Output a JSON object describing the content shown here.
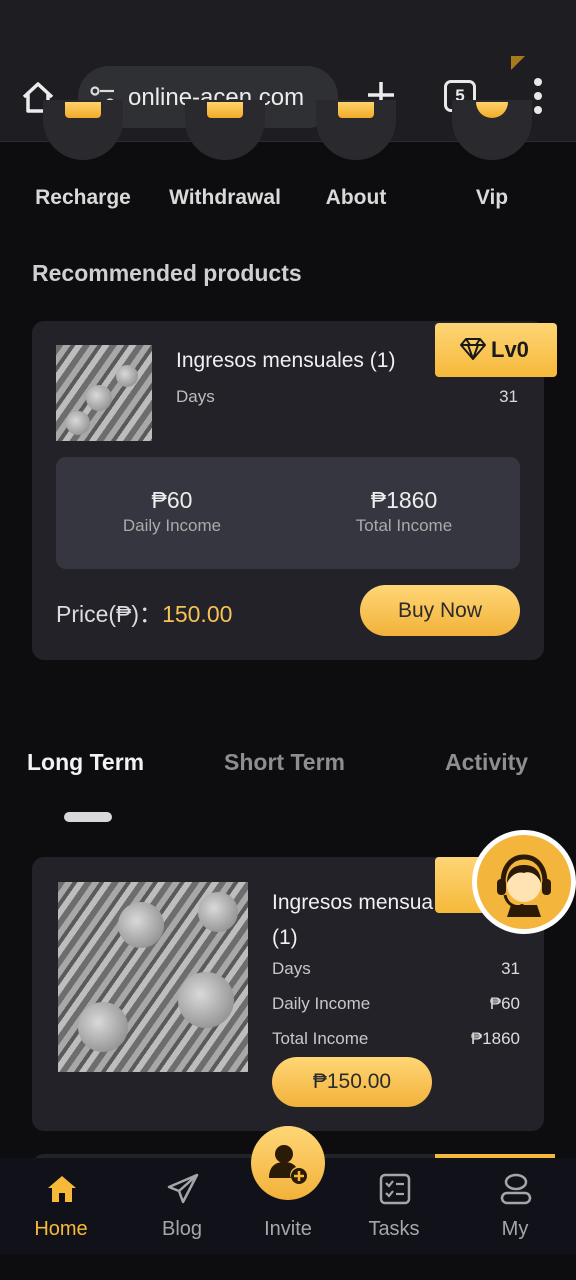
{
  "browser": {
    "url": "online-acen.com",
    "tab_count": "5"
  },
  "quick_nav": [
    {
      "label": "Recharge"
    },
    {
      "label": "Withdrawal"
    },
    {
      "label": "About"
    },
    {
      "label": "Vip"
    }
  ],
  "recommended": {
    "section_title": "Recommended products",
    "name": "Ingresos mensuales (1)",
    "level": "Lv0",
    "days_label": "Days",
    "days_value": "31",
    "daily_income_value": "₱60",
    "daily_income_label": "Daily Income",
    "total_income_value": "₱1860",
    "total_income_label": "Total Income",
    "price_label": "Price(₱)：",
    "price_value": "150.00",
    "buy_label": "Buy Now"
  },
  "tabs": [
    {
      "label": "Long Term",
      "active": true
    },
    {
      "label": "Short Term",
      "active": false
    },
    {
      "label": "Activity",
      "active": false
    }
  ],
  "product": {
    "name": "Ingresos mensua (1)",
    "name_line1": "Ingresos mensua",
    "name_line2": "(1)",
    "days_label": "Days",
    "days_value": "31",
    "daily_label": "Daily Income",
    "daily_value": "₱60",
    "total_label": "Total Income",
    "total_value": "₱1860",
    "price_button": "₱150.00"
  },
  "bottom_nav": [
    {
      "label": "Home",
      "icon": "home-icon",
      "active": true
    },
    {
      "label": "Blog",
      "icon": "paper-plane-icon",
      "active": false
    },
    {
      "label": "Invite",
      "icon": "add-user-icon",
      "active": false
    },
    {
      "label": "Tasks",
      "icon": "checklist-icon",
      "active": false
    },
    {
      "label": "My",
      "icon": "profile-icon",
      "active": false
    }
  ],
  "colors": {
    "accent": "#f5b93a",
    "background": "#0d0d0f",
    "card": "#222228"
  }
}
